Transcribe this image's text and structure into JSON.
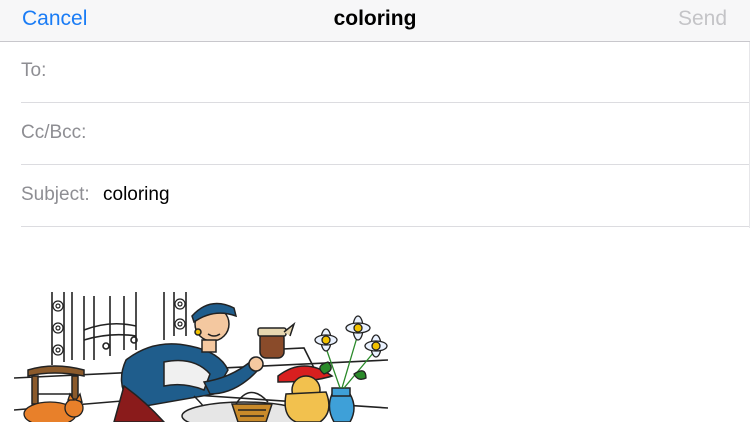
{
  "nav": {
    "cancel_label": "Cancel",
    "title": "coloring",
    "send_label": "Send"
  },
  "fields": {
    "to_label": "To:",
    "to_value": "",
    "cc_label": "Cc/Bcc:",
    "cc_value": "",
    "subject_label": "Subject:",
    "subject_value": "coloring"
  },
  "colors": {
    "accent": "#1a7cf5",
    "disabled": "#c4c4c7",
    "label": "#8e8e93"
  },
  "attachment": {
    "kind": "coloring page illustration",
    "description_icon": "image-icon"
  }
}
